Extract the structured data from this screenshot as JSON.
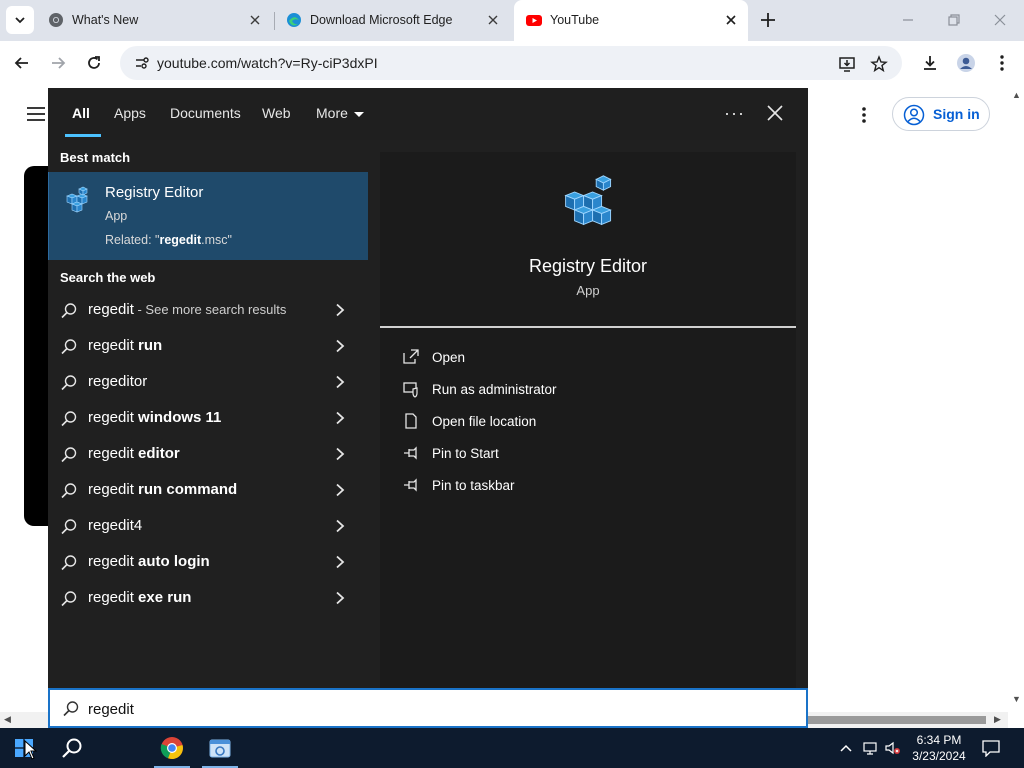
{
  "browser": {
    "tabs": [
      {
        "title": "What's New",
        "favicon": "chrome-icon"
      },
      {
        "title": "Download Microsoft Edge",
        "favicon": "edge-icon"
      },
      {
        "title": "YouTube",
        "favicon": "youtube-icon"
      }
    ],
    "active_tab": 2,
    "url": "youtube.com/watch?v=Ry-ciP3dxPI"
  },
  "youtube": {
    "sign_in_label": "Sign in"
  },
  "search": {
    "filters": [
      "All",
      "Apps",
      "Documents",
      "Web",
      "More"
    ],
    "active_filter": "All",
    "best_match_header": "Best match",
    "best_match": {
      "title": "Registry Editor",
      "type": "App",
      "related_prefix": "Related: \"",
      "related_bold": "regedit",
      "related_suffix": ".msc\""
    },
    "web_header": "Search the web",
    "web_results": [
      {
        "prefix": "regedit",
        "bold": "",
        "muted": " - See more search results"
      },
      {
        "prefix": "regedit ",
        "bold": "run",
        "muted": ""
      },
      {
        "prefix": "regeditor",
        "bold": "",
        "muted": ""
      },
      {
        "prefix": "regedit ",
        "bold": "windows 11",
        "muted": ""
      },
      {
        "prefix": "regedit ",
        "bold": "editor",
        "muted": ""
      },
      {
        "prefix": "regedit ",
        "bold": "run command",
        "muted": ""
      },
      {
        "prefix": "regedit4",
        "bold": "",
        "muted": ""
      },
      {
        "prefix": "regedit ",
        "bold": "auto login",
        "muted": ""
      },
      {
        "prefix": "regedit ",
        "bold": "exe run",
        "muted": ""
      }
    ],
    "detail": {
      "title": "Registry Editor",
      "type": "App",
      "actions": [
        "Open",
        "Run as administrator",
        "Open file location",
        "Pin to Start",
        "Pin to taskbar"
      ]
    },
    "query": "regedit"
  },
  "taskbar": {
    "time": "6:34 PM",
    "date": "3/23/2024"
  },
  "colors": {
    "panel_bg": "#202020",
    "best_match_bg": "#1f4a6b",
    "accent": "#4cc2ff",
    "taskbar_bg": "#0d1b2e",
    "youtube_signin": "#065fd4"
  }
}
